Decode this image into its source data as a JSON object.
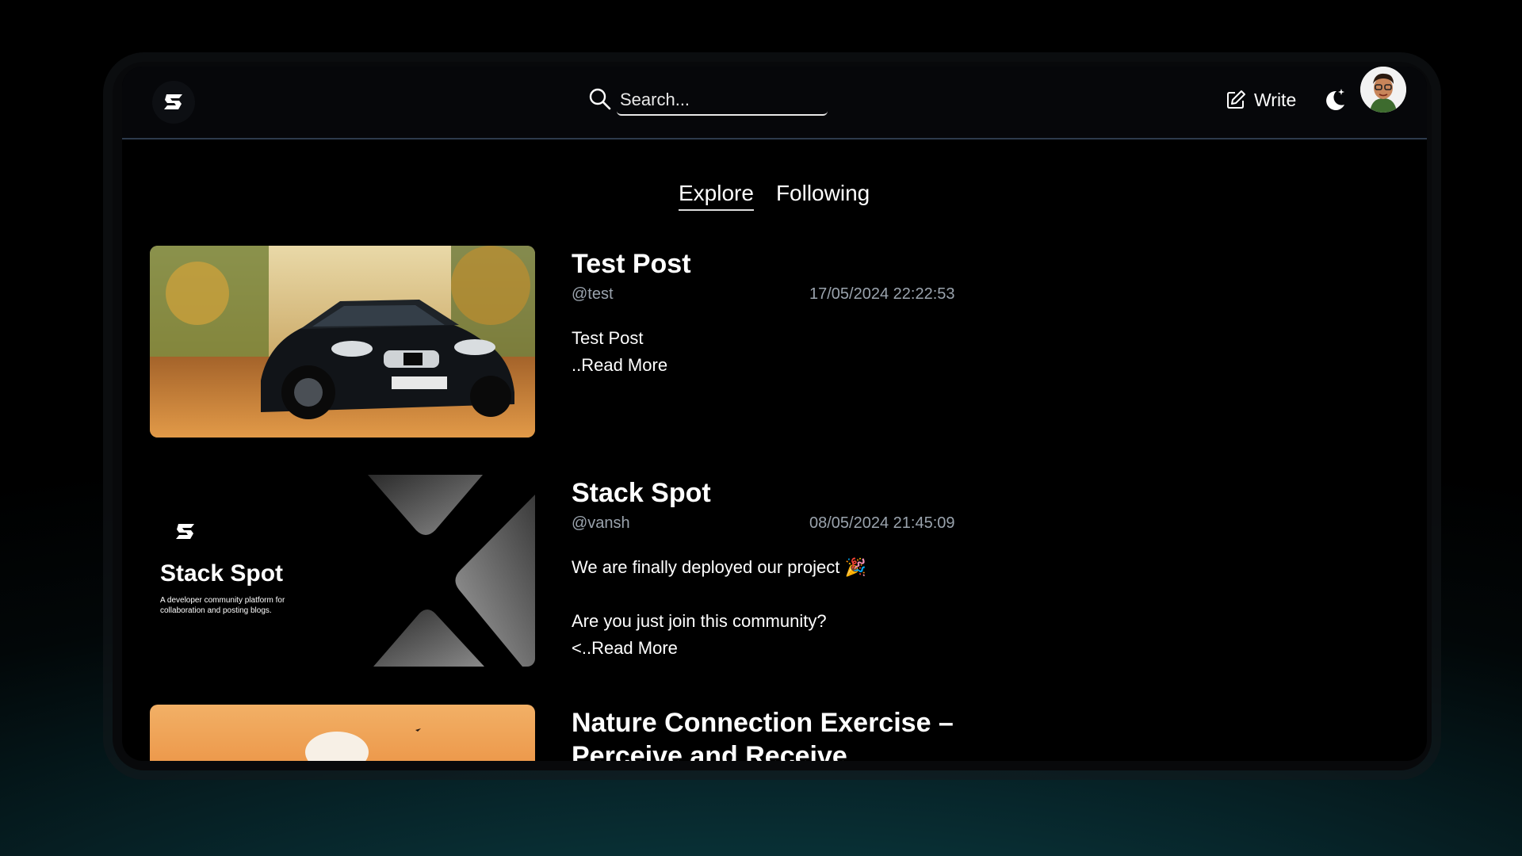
{
  "nav": {
    "search_placeholder": "Search...",
    "write_label": "Write"
  },
  "tabs": [
    {
      "label": "Explore",
      "active": true
    },
    {
      "label": "Following",
      "active": false
    }
  ],
  "posts": [
    {
      "title": "Test Post",
      "author": "@test",
      "date": "17/05/2024  22:22:53",
      "lines": [
        "Test Post"
      ],
      "read_more": "..Read More"
    },
    {
      "title": "Stack Spot",
      "author": "@vansh",
      "date": "08/05/2024  21:45:09",
      "lines": [
        "We are finally deployed our project 🎉",
        "Are you just join this community?"
      ],
      "read_more": "<..Read More",
      "thumb_title": "Stack Spot",
      "thumb_caption": "A developer community platform for collaboration and posting blogs."
    },
    {
      "title": "Nature Connection Exercise –",
      "title_line2": "Perceive and Receive"
    }
  ],
  "colors": {
    "accent_text": "#ffffff",
    "muted": "#9aa3ad",
    "divider": "#2d3a4c"
  }
}
